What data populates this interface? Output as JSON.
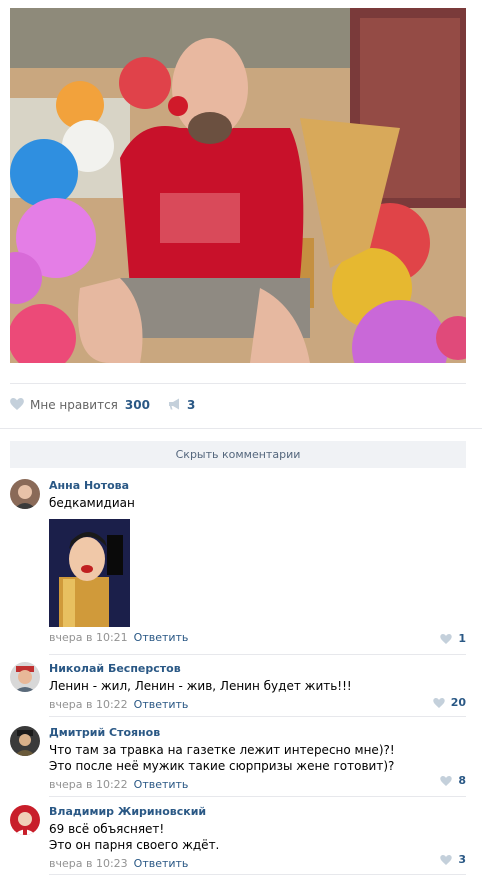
{
  "post": {
    "likes_label": "Мне нравится",
    "likes_count": "300",
    "shares_count": "3"
  },
  "hide_comments_label": "Скрыть комментарии",
  "comments": [
    {
      "author": "Анна Нотова",
      "lines": [
        "бедкамидиан"
      ],
      "time": "вчера в 10:21",
      "reply_label": "Ответить",
      "likes": "1"
    },
    {
      "author": "Николай Бесперстов",
      "lines": [
        "Ленин - жил, Ленин - жив, Ленин будет жить!!!"
      ],
      "time": "вчера в 10:22",
      "reply_label": "Ответить",
      "likes": "20"
    },
    {
      "author": "Дмитрий Стоянов",
      "lines": [
        "Что там за травка на газетке лежит интересно мне)?!",
        "Это после неё мужик такие сюрпризы жене готовит)?"
      ],
      "time": "вчера в 10:22",
      "reply_label": "Ответить",
      "likes": "8"
    },
    {
      "author": "Владимир Жириновский",
      "lines": [
        "69 всё объясняет!",
        "Это он парня своего ждёт."
      ],
      "time": "вчера в 10:23",
      "reply_label": "Ответить",
      "likes": "3"
    }
  ],
  "colors": {
    "link": "#2a5885",
    "meta": "#939393",
    "separator": "#e7e8ec",
    "button_bg": "#f0f2f5"
  },
  "icons": [
    "heart-icon",
    "megaphone-icon"
  ]
}
